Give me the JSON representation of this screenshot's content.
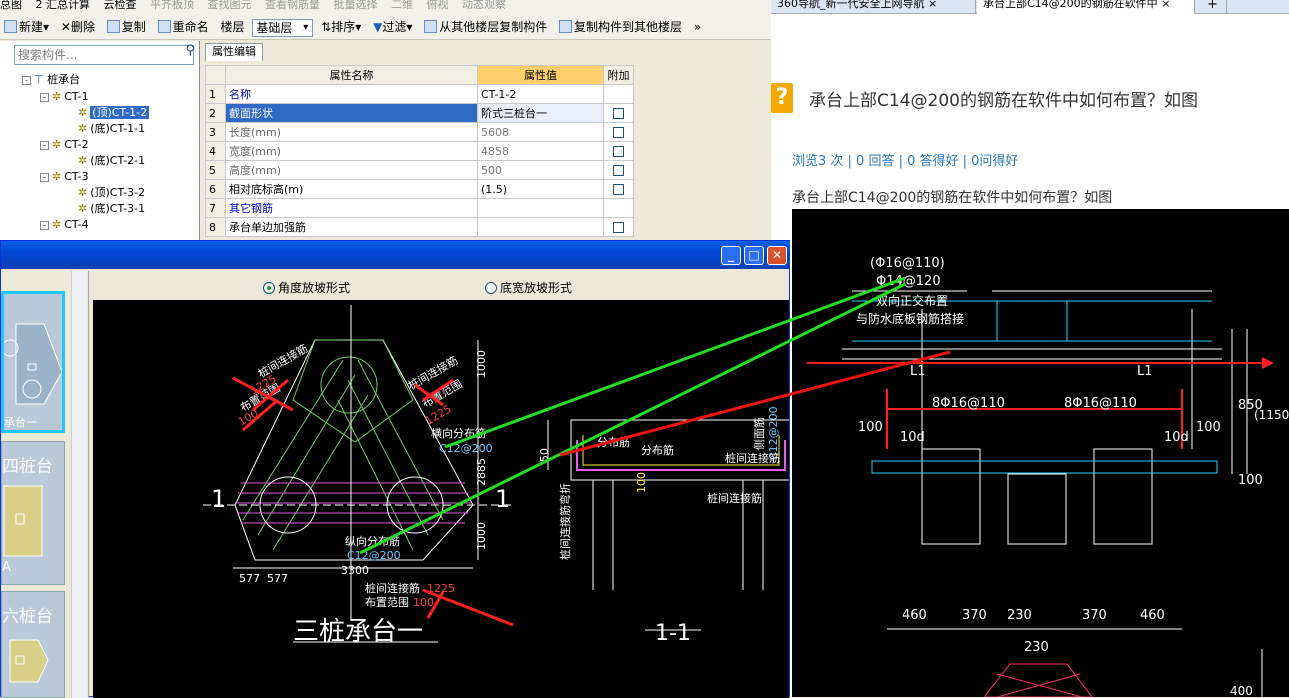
{
  "menubar": {
    "items": [
      "总图",
      "2 汇总计算",
      "云检查",
      "平齐板顶",
      "查找图元",
      "查看钢筋量",
      "批量选择",
      "二维",
      "俯视",
      "动态观察"
    ]
  },
  "toolbar": {
    "new": "新建",
    "delete": "删除",
    "copy": "复制",
    "rename": "重命名",
    "floor_label": "楼层",
    "floor_value": "基础层",
    "sort": "排序",
    "filter": "过滤",
    "copy_from": "从其他楼层复制构件",
    "copy_to": "复制构件到其他楼层",
    "more": "»"
  },
  "tree": {
    "search_placeholder": "搜索构件...",
    "search_icon": "magnifier-icon",
    "nodes": [
      {
        "label": "桩承台",
        "level": 0,
        "box": "-"
      },
      {
        "label": "CT-1",
        "level": 1,
        "box": "-"
      },
      {
        "label": "(顶)CT-1-2",
        "level": 2,
        "selected": true
      },
      {
        "label": "(底)CT-1-1",
        "level": 2
      },
      {
        "label": "CT-2",
        "level": 1,
        "box": "-"
      },
      {
        "label": "(底)CT-2-1",
        "level": 2
      },
      {
        "label": "CT-3",
        "level": 1,
        "box": "-"
      },
      {
        "label": "(顶)CT-3-2",
        "level": 2
      },
      {
        "label": "(底)CT-3-1",
        "level": 2
      },
      {
        "label": "CT-4",
        "level": 1,
        "box": "-"
      }
    ]
  },
  "properties": {
    "tab": "属性编辑",
    "headers": {
      "name": "属性名称",
      "value": "属性值",
      "extra": "附加"
    },
    "rows": [
      {
        "num": "1",
        "name": "名称",
        "value": "CT-1-2",
        "style": "blue",
        "check": false
      },
      {
        "num": "2",
        "name": "截面形状",
        "value": "阶式三桩台一",
        "style": "hl",
        "check": true
      },
      {
        "num": "3",
        "name": "长度(mm)",
        "value": "5608",
        "style": "gray",
        "check": true
      },
      {
        "num": "4",
        "name": "宽度(mm)",
        "value": "4858",
        "style": "gray",
        "check": true
      },
      {
        "num": "5",
        "name": "高度(mm)",
        "value": "500",
        "style": "gray",
        "check": true
      },
      {
        "num": "6",
        "name": "相对底标高(m)",
        "value": "(1.5)",
        "style": "normal",
        "check": true
      },
      {
        "num": "7",
        "name": "其它钢筋",
        "value": "",
        "style": "blue",
        "check": false
      },
      {
        "num": "8",
        "name": "承台单边加强筋",
        "value": "",
        "style": "normal",
        "check": true
      }
    ]
  },
  "browser": {
    "tabs": [
      "360导航_新一代安全上网导航",
      "承台上部C14@200的钢筋在软件中",
      "+"
    ],
    "question_icon": "?",
    "question_title": "承台上部C14@200的钢筋在软件中如何布置？如图",
    "stats": "浏览3 次 | 0 回答 | 0 答得好 | 0问得好",
    "body": "承台上部C14@200的钢筋在软件中如何布置？如图",
    "drawing_texts": {
      "t1": "(Φ16@110)",
      "t2": "Φ14@120",
      "t3": "双向正交布置",
      "t4": "与防水底板钢筋搭接",
      "l1": "L1",
      "l2": "L1",
      "bar1": "8Φ16@110",
      "bar2": "8Φ16@110",
      "d100a": "100",
      "d10a": "10d",
      "d10b": "10d",
      "d100b": "100",
      "d850": "850",
      "d1150": "(1150)",
      "d100c": "100",
      "dims": [
        "460",
        "370",
        "230",
        "370",
        "460"
      ],
      "d230": "230",
      "d400": "400"
    }
  },
  "dialog": {
    "radio1": "角度放坡形式",
    "radio2": "底宽放坡形式",
    "thumb_labels": [
      "承台一",
      "四桩台",
      "A",
      "六桩台"
    ],
    "cad": {
      "title": "三桩承台一",
      "section": "1-1",
      "mark_left": "1",
      "mark_right": "1",
      "labels": {
        "zjljj1": "桩间连接筋",
        "bzfw1": "布置范围",
        "v1225": "1225",
        "v100": "100",
        "zjljj2": "桩间连接筋",
        "bzfw2": "布置范围",
        "v1225b": "1225",
        "hxfbj": "横向分布筋",
        "c12": "C12@200",
        "zxfbj": "纵向分布筋",
        "c12b": "C12@200",
        "zjljj3": "桩间连接筋",
        "bzfw3": "布置范围",
        "v1225c": "1225",
        "v100c": "100",
        "fbj1": "分布筋",
        "fbj2": "分布筋",
        "cmj": "侧面筋",
        "c12c": "C12@200",
        "zjljj4": "桩间连接筋",
        "zjljj5": "桩间连接筋",
        "zjljjwz": "桩间连接筋弯折",
        "d50": "50",
        "d100": "100",
        "v1000a": "1000",
        "v2885": "2885",
        "v1000b": "1000",
        "v3300": "3300",
        "v577a": "577",
        "v577b": "577"
      }
    }
  }
}
